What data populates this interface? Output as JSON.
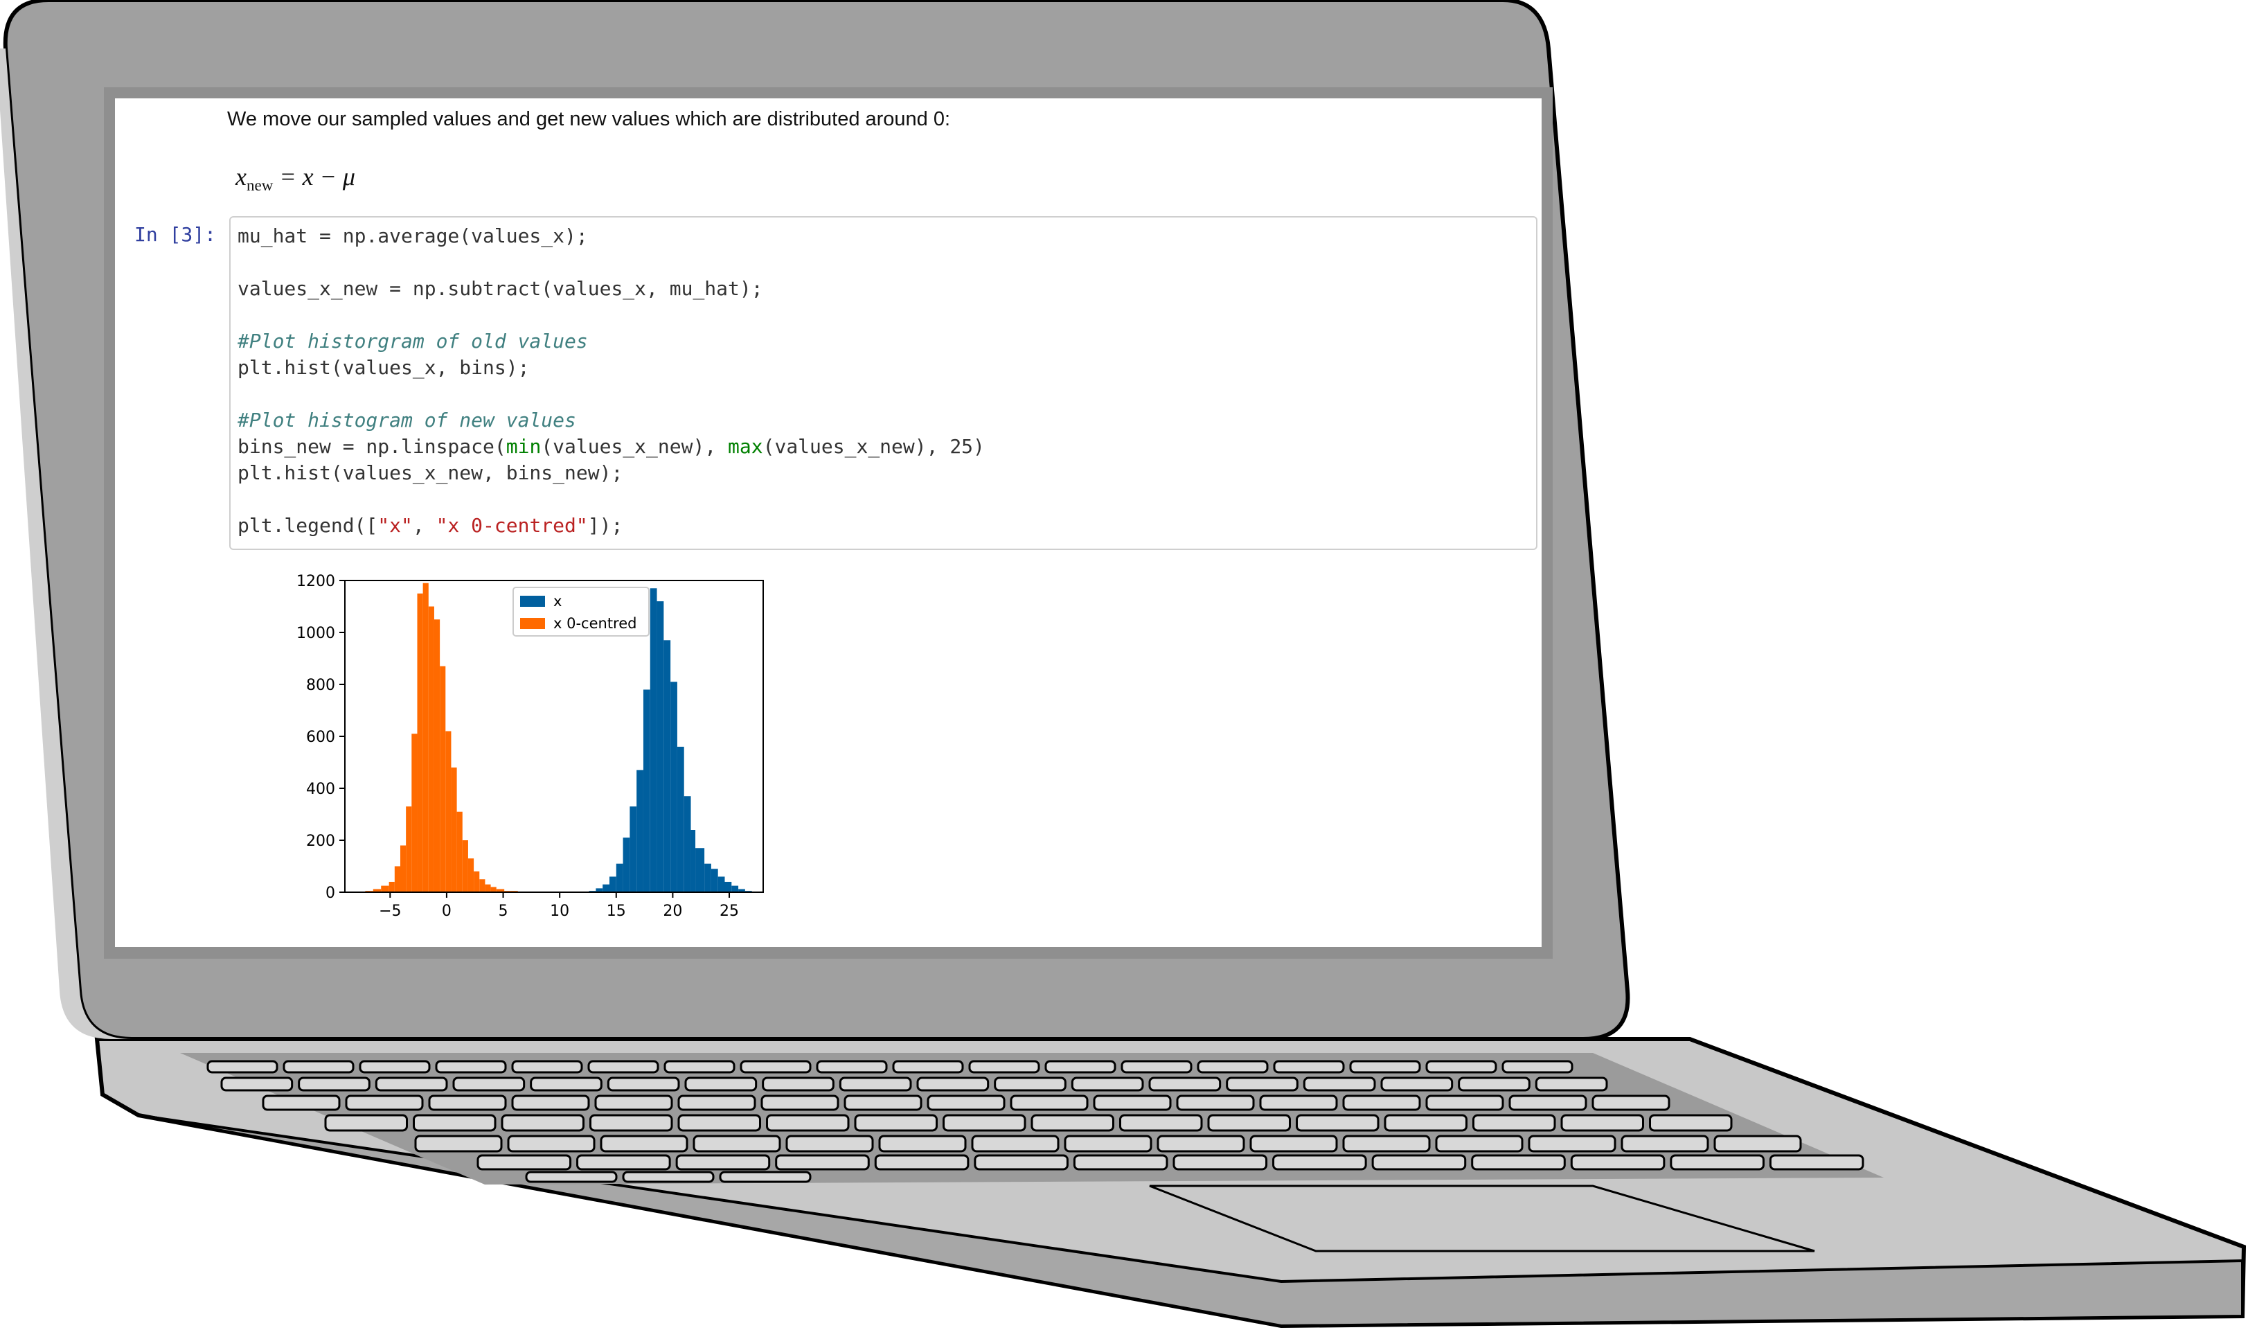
{
  "notebook": {
    "intro_text": "We move our sampled values and get new values which are distributed around 0:",
    "formula": {
      "lhs": "x",
      "subscript": "new",
      "rhs": "= x − μ"
    },
    "prompt": "In [3]:",
    "code_lines": [
      [
        {
          "t": "mu_hat = np.average(values_x);",
          "c": ""
        }
      ],
      [
        {
          "t": "",
          "c": ""
        }
      ],
      [
        {
          "t": "values_x_new = np.subtract(values_x, mu_hat);",
          "c": ""
        }
      ],
      [
        {
          "t": "",
          "c": ""
        }
      ],
      [
        {
          "t": "#Plot historgram of old values",
          "c": "cm"
        }
      ],
      [
        {
          "t": "plt.hist(values_x, bins);",
          "c": ""
        }
      ],
      [
        {
          "t": "",
          "c": ""
        }
      ],
      [
        {
          "t": "#Plot histogram of new values",
          "c": "cm"
        }
      ],
      [
        {
          "t": "bins_new = np.linspace(",
          "c": ""
        },
        {
          "t": "min",
          "c": "bi"
        },
        {
          "t": "(values_x_new), ",
          "c": ""
        },
        {
          "t": "max",
          "c": "bi"
        },
        {
          "t": "(values_x_new), 25)",
          "c": ""
        }
      ],
      [
        {
          "t": "plt.hist(values_x_new, bins_new);",
          "c": ""
        }
      ],
      [
        {
          "t": "",
          "c": ""
        }
      ],
      [
        {
          "t": "plt.legend([",
          "c": ""
        },
        {
          "t": "\"x\"",
          "c": "st"
        },
        {
          "t": ", ",
          "c": ""
        },
        {
          "t": "\"x 0-centred\"",
          "c": "st"
        },
        {
          "t": "]);",
          "c": ""
        }
      ]
    ]
  },
  "chart_data": {
    "type": "bar",
    "xlim": [
      -9,
      28
    ],
    "ylim": [
      0,
      1200
    ],
    "xticks": [
      -5,
      0,
      5,
      10,
      15,
      20,
      25
    ],
    "xtick_labels": [
      "−5",
      "0",
      "5",
      "10",
      "15",
      "20",
      "25"
    ],
    "yticks": [
      0,
      200,
      400,
      600,
      800,
      1000,
      1200
    ],
    "legend_position": "top-center",
    "colors": {
      "x": "#005f9e",
      "x 0-centred": "#ff6a00"
    },
    "series": [
      {
        "name": "x",
        "bin_edges": [
          12.6,
          13.2,
          13.8,
          14.4,
          15.0,
          15.6,
          16.2,
          16.8,
          17.4,
          18.0,
          18.6,
          19.2,
          19.8,
          20.4,
          21.0,
          21.6,
          22.0,
          22.8,
          23.4,
          24.0,
          24.6,
          25.2,
          25.8,
          26.4,
          27.0
        ],
        "values": [
          5,
          15,
          30,
          60,
          110,
          210,
          330,
          470,
          780,
          1170,
          1120,
          970,
          810,
          560,
          370,
          240,
          170,
          110,
          90,
          60,
          40,
          25,
          12,
          5
        ]
      },
      {
        "name": "x 0-centred",
        "bin_edges": [
          -7.2,
          -6.5,
          -5.8,
          -5.1,
          -4.6,
          -4.1,
          -3.6,
          -3.1,
          -2.6,
          -2.1,
          -1.6,
          -1.1,
          -0.6,
          -0.1,
          0.4,
          0.9,
          1.4,
          1.9,
          2.4,
          2.9,
          3.4,
          3.9,
          4.4,
          5.1,
          5.6,
          6.3
        ],
        "values": [
          5,
          12,
          25,
          40,
          100,
          180,
          330,
          610,
          1150,
          1190,
          1100,
          1050,
          870,
          620,
          480,
          310,
          200,
          130,
          80,
          50,
          30,
          20,
          12,
          5,
          5
        ]
      }
    ]
  }
}
